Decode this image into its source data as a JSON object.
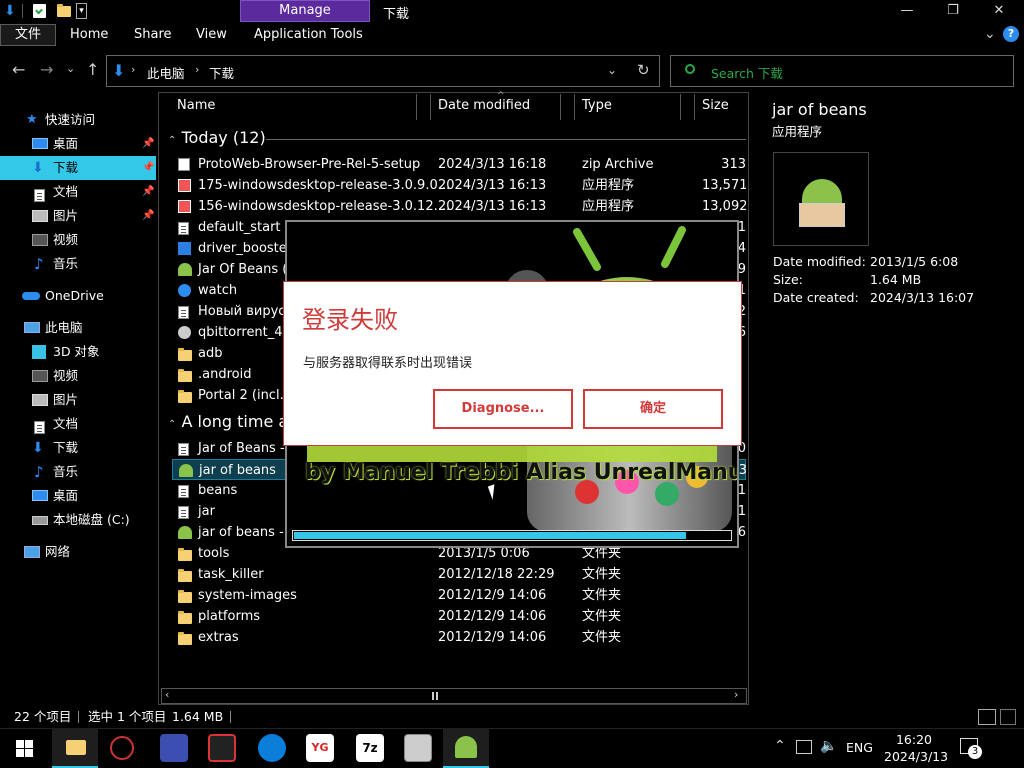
{
  "titlebar": {
    "context_tab": "Manage",
    "title": "下载",
    "minimize": "—",
    "maximize": "❐",
    "close": "✕"
  },
  "ribbon": {
    "tabs": [
      "文件",
      "Home",
      "Share",
      "View",
      "Application Tools"
    ],
    "expand": "⌄",
    "help": "?"
  },
  "address": {
    "back": "←",
    "forward": "→",
    "recent": "⌄",
    "up": "↑",
    "path": [
      "此电脑",
      "下载"
    ],
    "path_sep": "›",
    "dropdown": "⌄",
    "refresh": "↻",
    "search_placeholder": "Search 下载"
  },
  "nav": {
    "quick_access": "快速访问",
    "quick_items": [
      "桌面",
      "下载",
      "文档",
      "图片",
      "视频",
      "音乐"
    ],
    "onedrive": "OneDrive",
    "this_pc": "此电脑",
    "pc_items": [
      "3D 对象",
      "视频",
      "图片",
      "文档",
      "下载",
      "音乐",
      "桌面",
      "本地磁盘 (C:)"
    ],
    "network": "网络"
  },
  "columns": {
    "name": "Name",
    "date": "Date modified",
    "type": "Type",
    "size": "Size"
  },
  "groups": {
    "today": "Today (12)",
    "long_ago": "A long time ag"
  },
  "rows_today": [
    {
      "name": "ProtoWeb-Browser-Pre-Rel-5-setup",
      "date": "2024/3/13 16:18",
      "type": "zip Archive",
      "size": "313"
    },
    {
      "name": "175-windowsdesktop-release-3.0.9.0...",
      "date": "2024/3/13 16:13",
      "type": "应用程序",
      "size": "13,571"
    },
    {
      "name": "156-windowsdesktop-release-3.0.12....",
      "date": "2024/3/13 16:13",
      "type": "应用程序",
      "size": "13,092"
    },
    {
      "name": "default_start",
      "date": "",
      "type": "",
      "size": "1"
    },
    {
      "name": "driver_booster_",
      "date": "",
      "type": "",
      "size": "4"
    },
    {
      "name": "Jar Of Beans (A",
      "date": "",
      "type": "",
      "size": "9"
    },
    {
      "name": "watch",
      "date": "",
      "type": "",
      "size": "1"
    },
    {
      "name": "Новый вирус",
      "date": "",
      "type": "",
      "size": "2"
    },
    {
      "name": "qbittorrent_4.6",
      "date": "",
      "type": "",
      "size": "6"
    },
    {
      "name": "adb",
      "date": "",
      "type": "",
      "size": ""
    },
    {
      "name": ".android",
      "date": "",
      "type": "",
      "size": ""
    },
    {
      "name": "Portal 2 (incl. U",
      "date": "",
      "type": "",
      "size": ""
    }
  ],
  "rows_old": [
    {
      "name": "Jar of Beans -",
      "date": "",
      "type": "",
      "size": "0"
    },
    {
      "name": "jar of beans",
      "date": "",
      "type": "",
      "size": "3"
    },
    {
      "name": "beans",
      "date": "",
      "type": "",
      "size": "1"
    },
    {
      "name": "jar",
      "date": "",
      "type": "",
      "size": "1"
    },
    {
      "name": "jar of beans - r",
      "date": "",
      "type": "",
      "size": "26"
    },
    {
      "name": "tools",
      "date": "2013/1/5 0:06",
      "type": "文件夹",
      "size": ""
    },
    {
      "name": "task_killer",
      "date": "2012/12/18 22:29",
      "type": "文件夹",
      "size": ""
    },
    {
      "name": "system-images",
      "date": "2012/12/9 14:06",
      "type": "文件夹",
      "size": ""
    },
    {
      "name": "platforms",
      "date": "2012/12/9 14:06",
      "type": "文件夹",
      "size": ""
    },
    {
      "name": "extras",
      "date": "2012/12/9 14:06",
      "type": "文件夹",
      "size": ""
    }
  ],
  "details": {
    "name": "jar of beans",
    "kind": "应用程序",
    "labels": [
      "Date modified:",
      "Size:",
      "Date created:"
    ],
    "values": [
      "2013/1/5 6:08",
      "1.64 MB",
      "2024/3/13 16:07"
    ]
  },
  "splash": {
    "credit": "by Manuel Trebbi Alias UnrealManu",
    "progress": 0.9
  },
  "dialog": {
    "title": "登录失败",
    "message": "与服务器取得联系时出现错误",
    "diagnose": "Diagnose...",
    "ok": "确定"
  },
  "status": {
    "count": "22 个项目",
    "selected": "选中 1 个项目",
    "size": "1.64 MB"
  },
  "taskbar": {
    "lang": "ENG",
    "time": "16:20",
    "date": "2024/3/13",
    "notif_count": "3"
  },
  "colors": {
    "accent": "#33c8e8",
    "manage_tab": "#5b2a9c",
    "dialog_red": "#d23a3a",
    "folder": "#f5d174"
  }
}
